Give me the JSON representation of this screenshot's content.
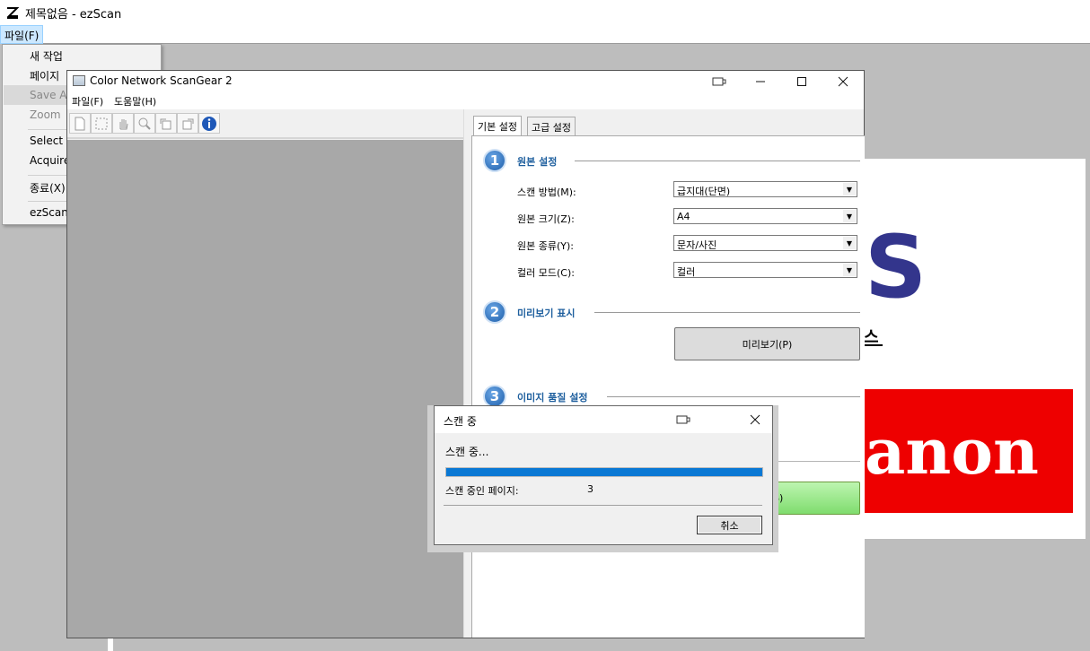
{
  "ezscan": {
    "title": "제목없음 - ezScan",
    "menu_file": "파일(F)",
    "dropdown": {
      "items": [
        "새 작업",
        "페이지",
        "Save As",
        "Zoom",
        "Select S",
        "Acquire",
        "종료(X)",
        "ezScan"
      ]
    }
  },
  "document": {
    "big_letter": "S",
    "korean_text": "스",
    "canon_text": "anon"
  },
  "scangear": {
    "title": "Color Network ScanGear 2",
    "menu": [
      "파일(F)",
      "도움말(H)"
    ],
    "tabs": [
      "기본 설정",
      "고급 설정"
    ],
    "sections": [
      {
        "num": "1",
        "title": "원본 설정"
      },
      {
        "num": "2",
        "title": "미리보기 표시"
      },
      {
        "num": "3",
        "title": "이미지 품질 설정"
      }
    ],
    "fields": [
      {
        "label": "스캔 방법(M):",
        "value": "급지대(단면)"
      },
      {
        "label": "원본 크기(Z):",
        "value": "A4"
      },
      {
        "label": "원본 종류(Y):",
        "value": "문자/사진"
      },
      {
        "label": "컬러 모드(C):",
        "value": "컬러"
      }
    ],
    "preview_button": "미리보기(P)",
    "scan_button_fragment": "S)"
  },
  "scan_dialog": {
    "title": "스캔 중",
    "status": "스캔 중...",
    "progress": 1.0,
    "pages_label": "스캔 중인 페이지:",
    "pages_value": "3",
    "cancel": "취소"
  },
  "colors": {
    "progress": "#0a78d4",
    "section_title": "#1e5f9e",
    "canon_red": "#ee0000",
    "logo_blue": "#33358c"
  }
}
